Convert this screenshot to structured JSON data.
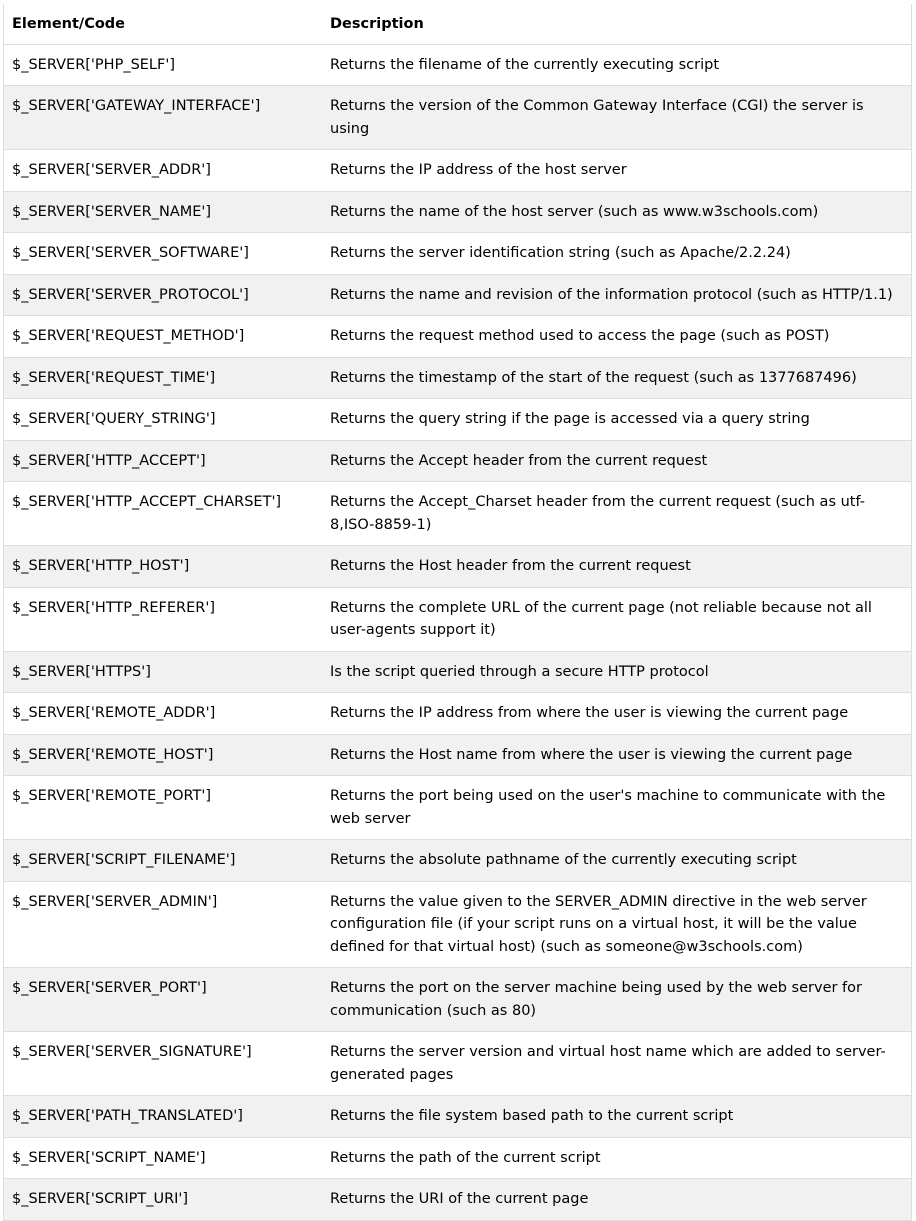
{
  "table": {
    "headers": [
      "Element/Code",
      "Description"
    ],
    "rows": [
      {
        "code": "$_SERVER['PHP_SELF']",
        "description": "Returns the filename of the currently executing script"
      },
      {
        "code": "$_SERVER['GATEWAY_INTERFACE']",
        "description": "Returns the version of the Common Gateway Interface (CGI) the server is using"
      },
      {
        "code": "$_SERVER['SERVER_ADDR']",
        "description": "Returns the IP address of the host server"
      },
      {
        "code": "$_SERVER['SERVER_NAME']",
        "description": "Returns the name of the host server (such as www.w3schools.com)"
      },
      {
        "code": "$_SERVER['SERVER_SOFTWARE']",
        "description": "Returns the server identification string (such as Apache/2.2.24)"
      },
      {
        "code": "$_SERVER['SERVER_PROTOCOL']",
        "description": "Returns the name and revision of the information protocol (such as HTTP/1.1)"
      },
      {
        "code": "$_SERVER['REQUEST_METHOD']",
        "description": "Returns the request method used to access the page (such as POST)"
      },
      {
        "code": "$_SERVER['REQUEST_TIME']",
        "description": "Returns the timestamp of the start of the request (such as 1377687496)"
      },
      {
        "code": "$_SERVER['QUERY_STRING']",
        "description": "Returns the query string if the page is accessed via a query string"
      },
      {
        "code": "$_SERVER['HTTP_ACCEPT']",
        "description": "Returns the Accept header from the current request"
      },
      {
        "code": "$_SERVER['HTTP_ACCEPT_CHARSET']",
        "description": "Returns the Accept_Charset header from the current request (such as utf-8,ISO-8859-1)"
      },
      {
        "code": "$_SERVER['HTTP_HOST']",
        "description": "Returns the Host header from the current request"
      },
      {
        "code": "$_SERVER['HTTP_REFERER']",
        "description": "Returns the complete URL of the current page (not reliable because not all user-agents support it)"
      },
      {
        "code": "$_SERVER['HTTPS']",
        "description": "Is the script queried through a secure HTTP protocol"
      },
      {
        "code": "$_SERVER['REMOTE_ADDR']",
        "description": "Returns the IP address from where the user is viewing the current page"
      },
      {
        "code": "$_SERVER['REMOTE_HOST']",
        "description": "Returns the Host name from where the user is viewing the current page"
      },
      {
        "code": "$_SERVER['REMOTE_PORT']",
        "description": "Returns the port being used on the user's machine to communicate with the web server"
      },
      {
        "code": "$_SERVER['SCRIPT_FILENAME']",
        "description": "Returns the absolute pathname of the currently executing script"
      },
      {
        "code": "$_SERVER['SERVER_ADMIN']",
        "description": "Returns the value given to the SERVER_ADMIN directive in the web server configuration file (if your script runs on a virtual host, it will be the value defined for that virtual host) (such as someone@w3schools.com)"
      },
      {
        "code": "$_SERVER['SERVER_PORT']",
        "description": "Returns the port on the server machine being used by the web server for communication (such as 80)"
      },
      {
        "code": "$_SERVER['SERVER_SIGNATURE']",
        "description": "Returns the server version and virtual host name which are added to server-generated pages"
      },
      {
        "code": "$_SERVER['PATH_TRANSLATED']",
        "description": "Returns the file system based path to the current script"
      },
      {
        "code": "$_SERVER['SCRIPT_NAME']",
        "description": "Returns the path of the current script"
      },
      {
        "code": "$_SERVER['SCRIPT_URI']",
        "description": "Returns the URI of the current page"
      }
    ]
  },
  "colors": {
    "border": "#dddddd",
    "stripe": "#f1f1f1",
    "text": "#000000"
  }
}
